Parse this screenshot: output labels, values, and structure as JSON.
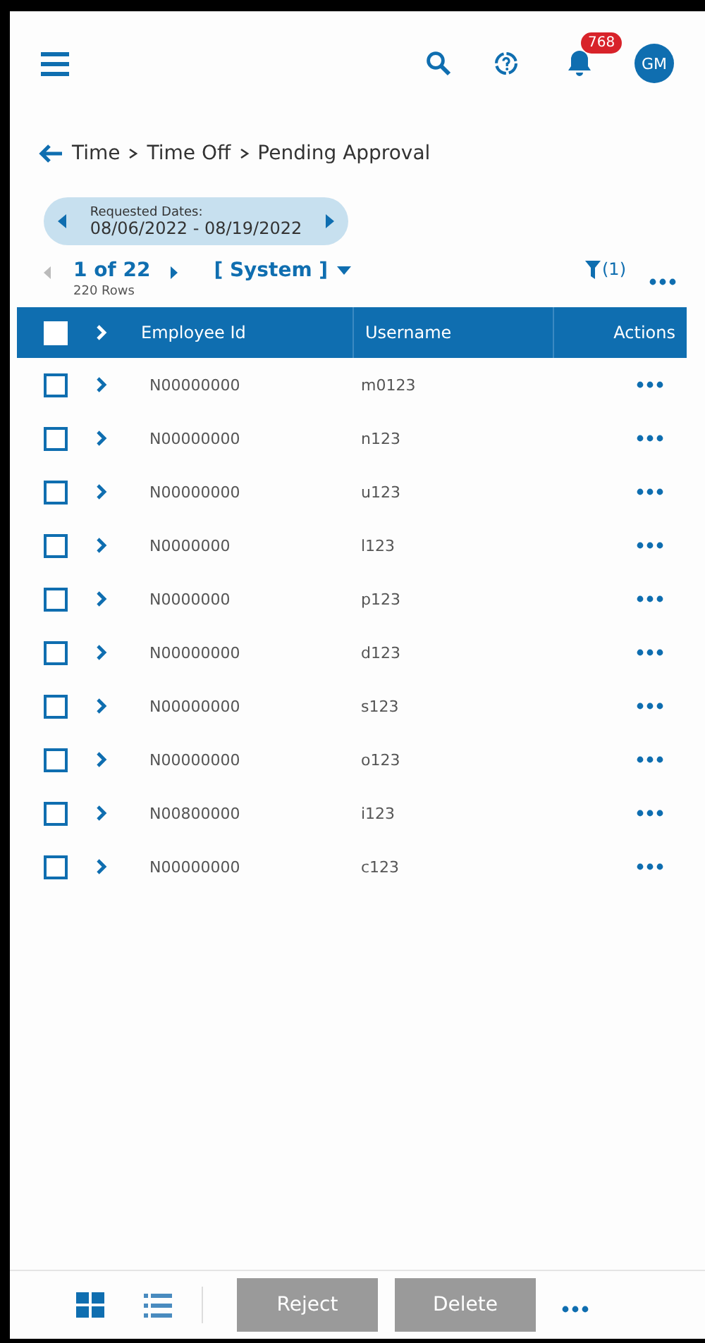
{
  "header": {
    "notification_count": "768",
    "avatar_initials": "GM"
  },
  "breadcrumb": [
    "Time",
    "Time Off",
    "Pending Approval"
  ],
  "date_filter": {
    "label": "Requested Dates:",
    "value": "08/06/2022 - 08/19/2022"
  },
  "pager": {
    "page": "1 of 22",
    "rows": "220 Rows",
    "view": "[ System ]",
    "filter_count": "(1)"
  },
  "table": {
    "select_all": {
      "checked": false
    },
    "columns": [
      "Employee Id",
      "Username",
      "Actions"
    ],
    "rows": [
      {
        "employee_id": "N00000000",
        "username": "m0123",
        "checked": false
      },
      {
        "employee_id": "N00000000",
        "username": "n123",
        "checked": false
      },
      {
        "employee_id": "N00000000",
        "username": "u123",
        "checked": false
      },
      {
        "employee_id": "N0000000",
        "username": "l123",
        "checked": false
      },
      {
        "employee_id": "N0000000",
        "username": "p123",
        "checked": false
      },
      {
        "employee_id": "N00000000",
        "username": "d123",
        "checked": false
      },
      {
        "employee_id": "N00000000",
        "username": "s123",
        "checked": false
      },
      {
        "employee_id": "N00000000",
        "username": "o123",
        "checked": false
      },
      {
        "employee_id": "N00800000",
        "username": "i123",
        "checked": false
      },
      {
        "employee_id": "N00000000",
        "username": "c123",
        "checked": false
      }
    ]
  },
  "footer": {
    "view_modes": [
      {
        "kind": "grid",
        "selected": true
      },
      {
        "kind": "list",
        "selected": false
      }
    ],
    "buttons": [
      {
        "label": "Reject",
        "disabled": true
      },
      {
        "label": "Delete",
        "disabled": true
      }
    ]
  }
}
